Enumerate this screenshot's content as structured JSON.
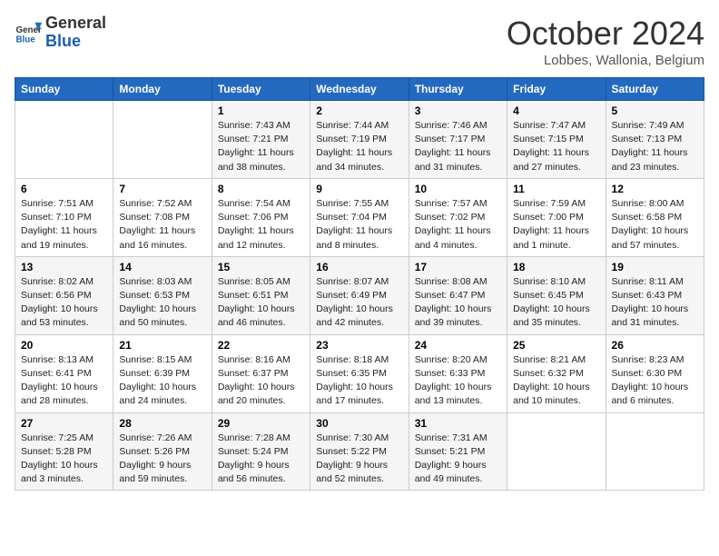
{
  "logo": {
    "line1": "General",
    "line2": "Blue"
  },
  "title": "October 2024",
  "subtitle": "Lobbes, Wallonia, Belgium",
  "days_of_week": [
    "Sunday",
    "Monday",
    "Tuesday",
    "Wednesday",
    "Thursday",
    "Friday",
    "Saturday"
  ],
  "weeks": [
    [
      {
        "day": "",
        "info": ""
      },
      {
        "day": "",
        "info": ""
      },
      {
        "day": "1",
        "info": "Sunrise: 7:43 AM\nSunset: 7:21 PM\nDaylight: 11 hours\nand 38 minutes."
      },
      {
        "day": "2",
        "info": "Sunrise: 7:44 AM\nSunset: 7:19 PM\nDaylight: 11 hours\nand 34 minutes."
      },
      {
        "day": "3",
        "info": "Sunrise: 7:46 AM\nSunset: 7:17 PM\nDaylight: 11 hours\nand 31 minutes."
      },
      {
        "day": "4",
        "info": "Sunrise: 7:47 AM\nSunset: 7:15 PM\nDaylight: 11 hours\nand 27 minutes."
      },
      {
        "day": "5",
        "info": "Sunrise: 7:49 AM\nSunset: 7:13 PM\nDaylight: 11 hours\nand 23 minutes."
      }
    ],
    [
      {
        "day": "6",
        "info": "Sunrise: 7:51 AM\nSunset: 7:10 PM\nDaylight: 11 hours\nand 19 minutes."
      },
      {
        "day": "7",
        "info": "Sunrise: 7:52 AM\nSunset: 7:08 PM\nDaylight: 11 hours\nand 16 minutes."
      },
      {
        "day": "8",
        "info": "Sunrise: 7:54 AM\nSunset: 7:06 PM\nDaylight: 11 hours\nand 12 minutes."
      },
      {
        "day": "9",
        "info": "Sunrise: 7:55 AM\nSunset: 7:04 PM\nDaylight: 11 hours\nand 8 minutes."
      },
      {
        "day": "10",
        "info": "Sunrise: 7:57 AM\nSunset: 7:02 PM\nDaylight: 11 hours\nand 4 minutes."
      },
      {
        "day": "11",
        "info": "Sunrise: 7:59 AM\nSunset: 7:00 PM\nDaylight: 11 hours\nand 1 minute."
      },
      {
        "day": "12",
        "info": "Sunrise: 8:00 AM\nSunset: 6:58 PM\nDaylight: 10 hours\nand 57 minutes."
      }
    ],
    [
      {
        "day": "13",
        "info": "Sunrise: 8:02 AM\nSunset: 6:56 PM\nDaylight: 10 hours\nand 53 minutes."
      },
      {
        "day": "14",
        "info": "Sunrise: 8:03 AM\nSunset: 6:53 PM\nDaylight: 10 hours\nand 50 minutes."
      },
      {
        "day": "15",
        "info": "Sunrise: 8:05 AM\nSunset: 6:51 PM\nDaylight: 10 hours\nand 46 minutes."
      },
      {
        "day": "16",
        "info": "Sunrise: 8:07 AM\nSunset: 6:49 PM\nDaylight: 10 hours\nand 42 minutes."
      },
      {
        "day": "17",
        "info": "Sunrise: 8:08 AM\nSunset: 6:47 PM\nDaylight: 10 hours\nand 39 minutes."
      },
      {
        "day": "18",
        "info": "Sunrise: 8:10 AM\nSunset: 6:45 PM\nDaylight: 10 hours\nand 35 minutes."
      },
      {
        "day": "19",
        "info": "Sunrise: 8:11 AM\nSunset: 6:43 PM\nDaylight: 10 hours\nand 31 minutes."
      }
    ],
    [
      {
        "day": "20",
        "info": "Sunrise: 8:13 AM\nSunset: 6:41 PM\nDaylight: 10 hours\nand 28 minutes."
      },
      {
        "day": "21",
        "info": "Sunrise: 8:15 AM\nSunset: 6:39 PM\nDaylight: 10 hours\nand 24 minutes."
      },
      {
        "day": "22",
        "info": "Sunrise: 8:16 AM\nSunset: 6:37 PM\nDaylight: 10 hours\nand 20 minutes."
      },
      {
        "day": "23",
        "info": "Sunrise: 8:18 AM\nSunset: 6:35 PM\nDaylight: 10 hours\nand 17 minutes."
      },
      {
        "day": "24",
        "info": "Sunrise: 8:20 AM\nSunset: 6:33 PM\nDaylight: 10 hours\nand 13 minutes."
      },
      {
        "day": "25",
        "info": "Sunrise: 8:21 AM\nSunset: 6:32 PM\nDaylight: 10 hours\nand 10 minutes."
      },
      {
        "day": "26",
        "info": "Sunrise: 8:23 AM\nSunset: 6:30 PM\nDaylight: 10 hours\nand 6 minutes."
      }
    ],
    [
      {
        "day": "27",
        "info": "Sunrise: 7:25 AM\nSunset: 5:28 PM\nDaylight: 10 hours\nand 3 minutes."
      },
      {
        "day": "28",
        "info": "Sunrise: 7:26 AM\nSunset: 5:26 PM\nDaylight: 9 hours\nand 59 minutes."
      },
      {
        "day": "29",
        "info": "Sunrise: 7:28 AM\nSunset: 5:24 PM\nDaylight: 9 hours\nand 56 minutes."
      },
      {
        "day": "30",
        "info": "Sunrise: 7:30 AM\nSunset: 5:22 PM\nDaylight: 9 hours\nand 52 minutes."
      },
      {
        "day": "31",
        "info": "Sunrise: 7:31 AM\nSunset: 5:21 PM\nDaylight: 9 hours\nand 49 minutes."
      },
      {
        "day": "",
        "info": ""
      },
      {
        "day": "",
        "info": ""
      }
    ]
  ]
}
